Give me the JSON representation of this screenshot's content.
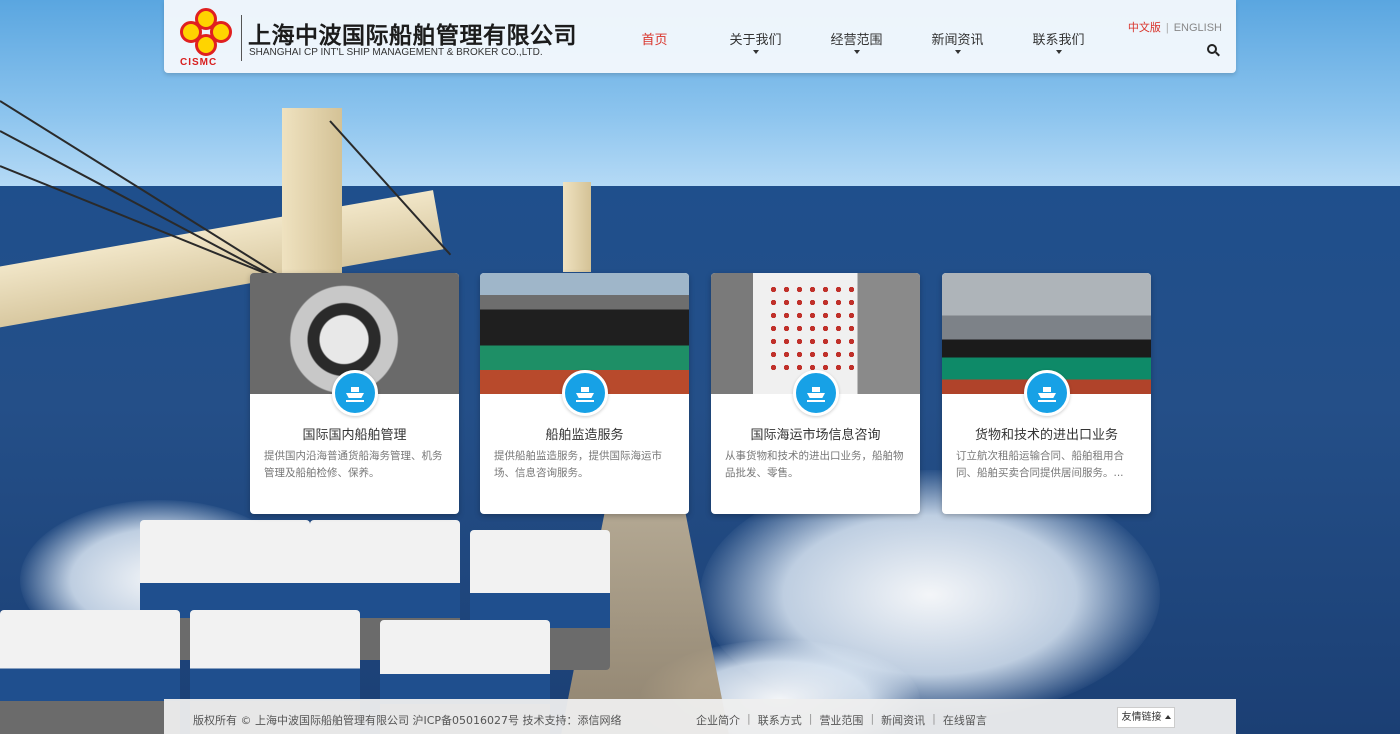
{
  "company": {
    "abbr": "CISMC",
    "name_cn": "上海中波国际船舶管理有限公司",
    "name_en": "SHANGHAI CP INT'L SHIP MANAGEMENT & BROKER CO.,LTD."
  },
  "nav": {
    "items": [
      {
        "label": "首页",
        "active": true
      },
      {
        "label": "关于我们",
        "has_dropdown": true
      },
      {
        "label": "经营范围",
        "has_dropdown": true
      },
      {
        "label": "新闻资讯",
        "has_dropdown": true
      },
      {
        "label": "联系我们",
        "has_dropdown": true
      }
    ]
  },
  "lang": {
    "current": "中文版",
    "separator": "|",
    "other": "ENGLISH"
  },
  "search": {
    "icon": "search-icon"
  },
  "cards": [
    {
      "title": "国际国内船舶管理",
      "desc": "提供国内沿海普通货船海务管理、机务管理及船舶检修、保养。",
      "icon": "ship-icon"
    },
    {
      "title": "船舶监造服务",
      "desc": "提供船舶监造服务，提供国际海运市场、信息咨询服务。",
      "icon": "ship-icon"
    },
    {
      "title": "国际海运市场信息咨询",
      "desc": "从事货物和技术的进出口业务，船舶物品批发、零售。",
      "icon": "ship-icon"
    },
    {
      "title": "货物和技术的进出口业务",
      "desc": "订立航次租船运输合同、船舶租用合同、船舶买卖合同提供居间服务。...",
      "icon": "ship-icon"
    }
  ],
  "footer": {
    "copyright": "版权所有 © 上海中波国际船舶管理有限公司 沪ICP备05016027号 技术支持：添信网络",
    "links": [
      "企业简介",
      "联系方式",
      "营业范围",
      "新闻资讯",
      "在线留言"
    ],
    "separator": "|",
    "friend_links": "友情链接"
  },
  "colors": {
    "accent": "#d9342b",
    "icon_bg": "#17a1e6"
  }
}
